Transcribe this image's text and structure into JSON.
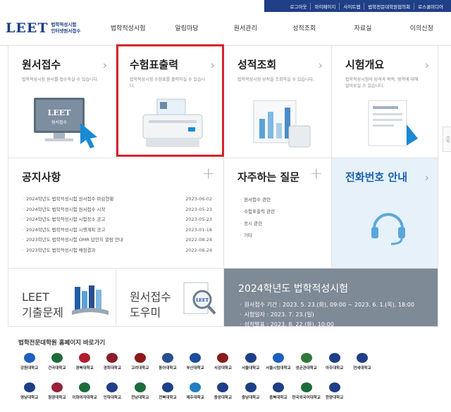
{
  "utility": [
    "로그아웃",
    "마이페이지",
    "사이트맵",
    "법학전문대학원협의회",
    "로스쿨미디어"
  ],
  "logo": {
    "text": "LEET",
    "sub1": "법학적성시험",
    "sub2": "인터넷원서접수"
  },
  "gnb": [
    "법학적성시험",
    "알림마당",
    "원서관리",
    "성적조회",
    "자료실",
    "이의신청"
  ],
  "tiles": {
    "apply": {
      "title": "원서접수",
      "desc": "법학적성시험 원서를 접수하실 수 있습니다."
    },
    "ticket": {
      "title": "수험표출력",
      "desc": "법학적성시험 수험표를 출력하실 수 있습니다."
    },
    "score": {
      "title": "성적조회",
      "desc": "법학적성시험 성적을 조회하실 수 있습니다."
    },
    "overview": {
      "title": "시험개요",
      "desc": "법학적성시험의 성격과 목적, 영역에 대해 알아보실 수 있습니다."
    }
  },
  "monitor_text": {
    "leet": "LEET",
    "sub": "원서접수"
  },
  "notice": {
    "title": "공지사항",
    "items": [
      {
        "title": "2024학년도 법학적성시험 원서접수 마감현황",
        "date": "2023-06-02"
      },
      {
        "title": "2024학년도 법학적성시험 원서접수 시작",
        "date": "2023-05-23"
      },
      {
        "title": "2024학년도 법학적성시험 시험장소 공고",
        "date": "2023-05-23"
      },
      {
        "title": "2024학년도 법학적성시험 시행계획 공고",
        "date": "2023-01-18"
      },
      {
        "title": "2023학년도 법학적성시험 OMR 답안지 열람 안내",
        "date": "2022-08-24"
      },
      {
        "title": "2023학년도 법학적성시험 채점결과",
        "date": "2022-08-24"
      }
    ]
  },
  "faq": {
    "title": "자주하는 질문",
    "items": [
      "원서접수 관련",
      "수험표출력 관련",
      "응시 관련",
      "기타"
    ]
  },
  "phone": {
    "title": "전화번호 안내"
  },
  "past": {
    "line1": "LEET",
    "line2": "기출문제"
  },
  "helper": {
    "line1": "원서접수",
    "line2": "도우미"
  },
  "exam": {
    "title": "2024학년도 법학적성시험",
    "items": [
      "원서접수 기간 : 2023. 5. 23.(화), 09:00 ~ 2023. 6. 1.(목), 18:00",
      "시험일자 : 2023. 7. 23.(일)",
      "성적발표 : 2023. 8. 22.(화), 10:00"
    ]
  },
  "schools_title": "법학전문대학원 홈페이지 바로가기",
  "schools": [
    {
      "name": "강원대학교",
      "color": "#1f5fbf"
    },
    {
      "name": "건국대학교",
      "color": "#1d6b3a"
    },
    {
      "name": "경북대학교",
      "color": "#b01e2e"
    },
    {
      "name": "경희대학교",
      "color": "#8a1d2a"
    },
    {
      "name": "고려대학교",
      "color": "#8b1a1a"
    },
    {
      "name": "동아대학교",
      "color": "#2a4f8f"
    },
    {
      "name": "부산대학교",
      "color": "#1b4ea0"
    },
    {
      "name": "서강대학교",
      "color": "#8a1b1b"
    },
    {
      "name": "서울대학교",
      "color": "#1f3f86"
    },
    {
      "name": "서울시립대학교",
      "color": "#1f5fbf"
    },
    {
      "name": "성균관대학교",
      "color": "#2f7a3a"
    },
    {
      "name": "아주대학교",
      "color": "#1f3f86"
    },
    {
      "name": "연세대학교",
      "color": "#1f3f86"
    },
    {
      "name": "",
      "color": "#ffffff"
    },
    {
      "name": "",
      "color": "#ffffff"
    },
    {
      "name": "영남대학교",
      "color": "#1f3f86"
    },
    {
      "name": "원광대학교",
      "color": "#9a1f3a"
    },
    {
      "name": "이화여자대학교",
      "color": "#1d6b3a"
    },
    {
      "name": "인하대학교",
      "color": "#1f3f86"
    },
    {
      "name": "전남대학교",
      "color": "#1d6b3a"
    },
    {
      "name": "전북대학교",
      "color": "#1f3f86"
    },
    {
      "name": "제주대학교",
      "color": "#1f7fbf"
    },
    {
      "name": "중앙대학교",
      "color": "#1f3f86"
    },
    {
      "name": "충남대학교",
      "color": "#1f3f86"
    },
    {
      "name": "충북대학교",
      "color": "#1f3f86"
    },
    {
      "name": "한국외국어대학교",
      "color": "#1d6b3a"
    },
    {
      "name": "한양대학교",
      "color": "#1f3f86"
    },
    {
      "name": "",
      "color": "#ffffff"
    },
    {
      "name": "",
      "color": "#ffffff"
    },
    {
      "name": "",
      "color": "#ffffff"
    }
  ],
  "top_button": "TOP",
  "colors": {
    "brand": "#1f3f86",
    "highlight": "#d8232a",
    "exam_bg": "#7e8a96",
    "phone_blue": "#1a5fb4"
  }
}
